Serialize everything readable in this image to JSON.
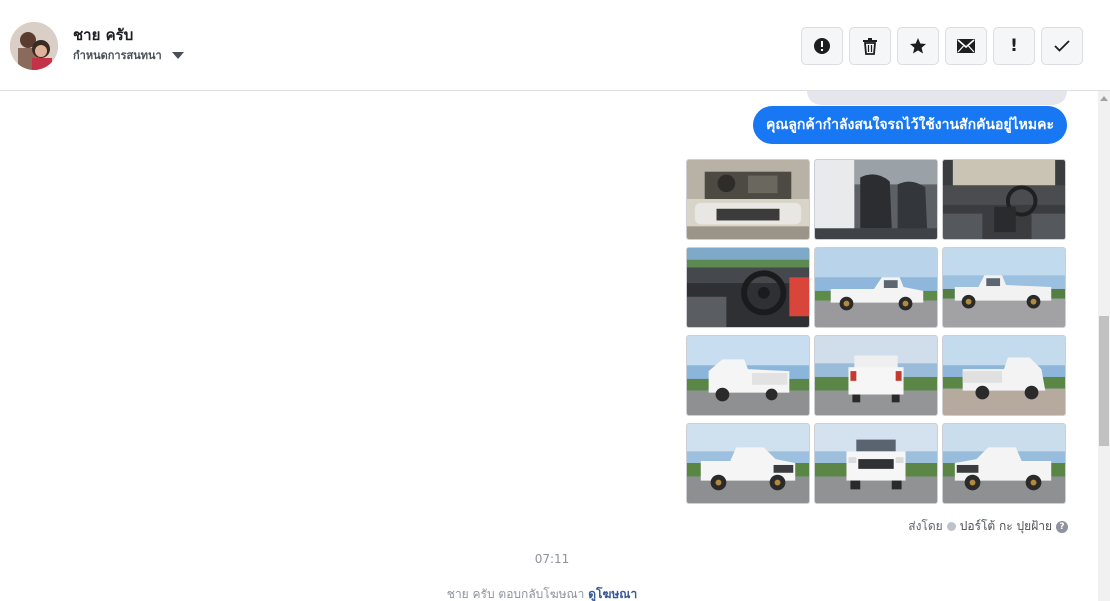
{
  "header": {
    "user_name": "ชาย ครับ",
    "assign_label": "กำหนดการสนทนา",
    "actions": [
      {
        "name": "spam-button",
        "icon": "alert-circle-icon",
        "glyph": ""
      },
      {
        "name": "delete-button",
        "icon": "trash-icon",
        "glyph": ""
      },
      {
        "name": "star-button",
        "icon": "star-icon",
        "glyph": ""
      },
      {
        "name": "mark-unread-button",
        "icon": "envelope-icon",
        "glyph": ""
      },
      {
        "name": "follow-up-button",
        "icon": "exclamation-icon",
        "glyph": "!"
      },
      {
        "name": "mark-done-button",
        "icon": "checkmark-icon",
        "glyph": ""
      }
    ]
  },
  "thread": {
    "message": "คุณลูกค้ากำลังสนใจรถไว้ใช้งานสักคันอยู่ไหมคะ",
    "photos": [
      {
        "name": "photo-engine",
        "subject": "engine"
      },
      {
        "name": "photo-seats",
        "subject": "interior-seats"
      },
      {
        "name": "photo-dashboard",
        "subject": "interior-dashboard"
      },
      {
        "name": "photo-steering",
        "subject": "interior-steering"
      },
      {
        "name": "photo-side-1",
        "subject": "truck-side"
      },
      {
        "name": "photo-side-2",
        "subject": "truck-side"
      },
      {
        "name": "photo-rear-left",
        "subject": "truck-rear-angle"
      },
      {
        "name": "photo-rear",
        "subject": "truck-rear"
      },
      {
        "name": "photo-rear-right",
        "subject": "truck-rear-angle"
      },
      {
        "name": "photo-front-left",
        "subject": "truck-front-angle"
      },
      {
        "name": "photo-front",
        "subject": "truck-front"
      },
      {
        "name": "photo-front-right",
        "subject": "truck-front-angle"
      }
    ],
    "sent_by_label": "ส่งโดย",
    "sent_by_name": "ปอร์โต้ กะ ปุยฝ้าย",
    "help_glyph": "?",
    "time": "07:11",
    "reply_text": "ชาย ครับ ตอบกลับโฆษณา",
    "view_ad_link": "ดูโฆษณา"
  },
  "colors": {
    "accent": "#1877f2",
    "link": "#385898"
  }
}
